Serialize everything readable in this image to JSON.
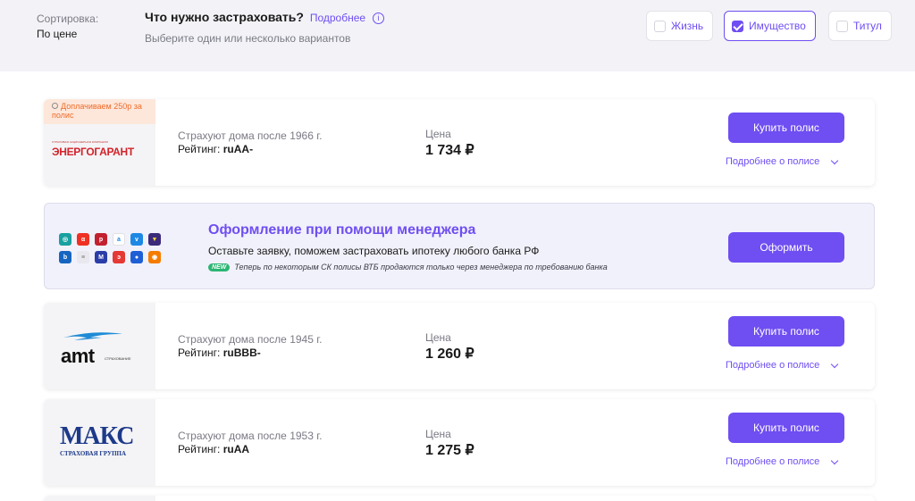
{
  "filters": {
    "sort_label": "Сортировка:",
    "sort_value": "По цене",
    "question": "Что нужно застраховать?",
    "more_link": "Подробнее",
    "subtitle": "Выберите один или несколько вариантов",
    "options": [
      {
        "label": "Жизнь",
        "checked": false
      },
      {
        "label": "Имущество",
        "checked": true
      },
      {
        "label": "Титул",
        "checked": false
      }
    ]
  },
  "offers": [
    {
      "promo": "Доплачиваем 250р за полис",
      "company_logo_text": "ЭНЕРГОГАРАНТ",
      "company_logo_tagline": "СТРАХОВАЯ АКЦИОНЕРНАЯ КОМПАНИЯ",
      "description": "Страхуют дома после 1966 г.",
      "rating_label": "Рейтинг:",
      "rating_value": "ruAA-",
      "price_label": "Цена",
      "price": "1 734 ₽",
      "buy_label": "Купить полис",
      "more_label": "Подробнее о полисе"
    },
    {
      "company_logo_text": "amt",
      "company_logo_tagline": "СТРАХОВАНИЕ",
      "description": "Страхуют дома после 1945 г.",
      "rating_label": "Рейтинг:",
      "rating_value": "ruBBB-",
      "price_label": "Цена",
      "price": "1 260 ₽",
      "buy_label": "Купить полис",
      "more_label": "Подробнее о полисе"
    },
    {
      "company_logo_text": "МАКС",
      "company_logo_tagline": "СТРАХОВАЯ ГРУППА",
      "description": "Страхуют дома после 1953 г.",
      "rating_label": "Рейтинг:",
      "rating_value": "ruAA",
      "price_label": "Цена",
      "price": "1 275 ₽",
      "buy_label": "Купить полис",
      "more_label": "Подробнее о полисе"
    }
  ],
  "manager": {
    "title": "Оформление при помощи менеджера",
    "text": "Оставьте заявку, поможем застраховать ипотеку любого банка РФ",
    "badge": "NEW",
    "note": "Теперь по некоторым СК полисы ВТБ продаются только через менеджера по требованию банка",
    "button": "Оформить"
  },
  "colors": {
    "accent": "#6f4ef2",
    "promo_bg": "#fde7da",
    "promo_text": "#ef6b2a",
    "new_badge": "#2bb673"
  }
}
